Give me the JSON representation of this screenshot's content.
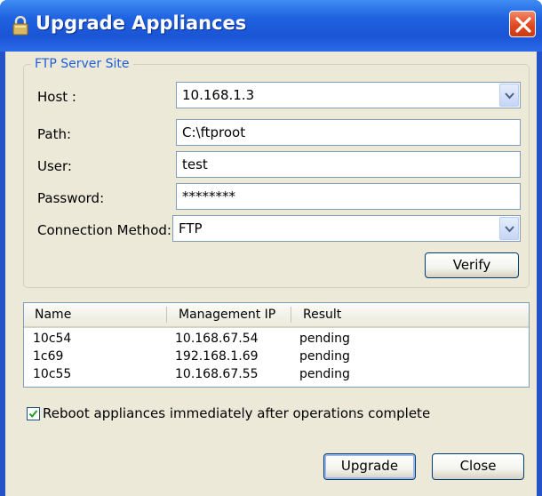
{
  "window": {
    "title": "Upgrade Appliances",
    "title_icon": "lock-icon",
    "close_icon": "close-icon"
  },
  "ftp_group": {
    "legend": "FTP Server Site",
    "host": {
      "label": "Host :",
      "value": "10.168.1.3"
    },
    "path": {
      "label": "Path:",
      "value": "C:\\ftproot"
    },
    "user": {
      "label": "User:",
      "value": "test"
    },
    "password": {
      "label": "Password:",
      "value": "********"
    },
    "connection_method": {
      "label": "Connection Method:",
      "value": "FTP"
    },
    "verify_label": "Verify"
  },
  "appliances_table": {
    "columns": [
      "Name",
      "Management IP",
      "Result"
    ],
    "rows": [
      [
        "10c54",
        "10.168.67.54",
        "pending"
      ],
      [
        "1c69",
        "192.168.1.69",
        "pending"
      ],
      [
        "10c55",
        "10.168.67.55",
        "pending"
      ]
    ]
  },
  "reboot_option": {
    "label": "Reboot appliances immediately after operations complete",
    "checked": true
  },
  "buttons": {
    "upgrade": "Upgrade",
    "close": "Close"
  },
  "colors": {
    "titlebar": "#1f62e0",
    "dialog_bg": "#ece9d8",
    "legend": "#1d5fd8"
  }
}
